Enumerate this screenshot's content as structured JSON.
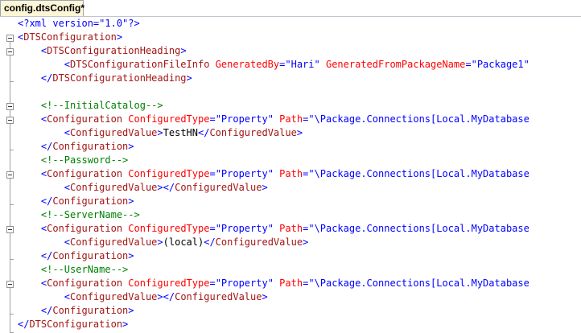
{
  "tab": {
    "title": "config.dtsConfig*"
  },
  "code": {
    "decl": "<?xml version=\"1.0\"?>",
    "root_open": "DTSConfiguration",
    "heading_open": "DTSConfigurationHeading",
    "fileinfo_tag": "DTSConfigurationFileInfo",
    "attr_generated_by": "GeneratedBy",
    "val_generated_by": "\"Hari\"",
    "attr_generated_from": "GeneratedFromPackageName",
    "val_generated_from": "\"Package1\"",
    "heading_close": "DTSConfigurationHeading",
    "configs": [
      {
        "comment": "<!--InitialCatalog-->",
        "tag": "Configuration",
        "attr_type": "ConfiguredType",
        "val_type": "\"Property\"",
        "attr_path": "Path",
        "val_path": "\"\\Package.Connections[Local.MyDatabase",
        "value_tag": "ConfiguredValue",
        "value_text": "TestHN"
      },
      {
        "comment": "<!--Password-->",
        "tag": "Configuration",
        "attr_type": "ConfiguredType",
        "val_type": "\"Property\"",
        "attr_path": "Path",
        "val_path": "\"\\Package.Connections[Local.MyDatabase",
        "value_tag": "ConfiguredValue",
        "value_text": ""
      },
      {
        "comment": "<!--ServerName-->",
        "tag": "Configuration",
        "attr_type": "ConfiguredType",
        "val_type": "\"Property\"",
        "attr_path": "Path",
        "val_path": "\"\\Package.Connections[Local.MyDatabase",
        "value_tag": "ConfiguredValue",
        "value_text": "(local)"
      },
      {
        "comment": "<!--UserName-->",
        "tag": "Configuration",
        "attr_type": "ConfiguredType",
        "val_type": "\"Property\"",
        "attr_path": "Path",
        "val_path": "\"\\Package.Connections[Local.MyDatabase",
        "value_tag": "ConfiguredValue",
        "value_text": ""
      }
    ],
    "root_close": "DTSConfiguration"
  },
  "colors": {
    "tag": "#a31515",
    "bracket": "#0000ff",
    "attribute": "#ff0000",
    "comment": "#008000",
    "tab_active": "#fdf6d6"
  }
}
